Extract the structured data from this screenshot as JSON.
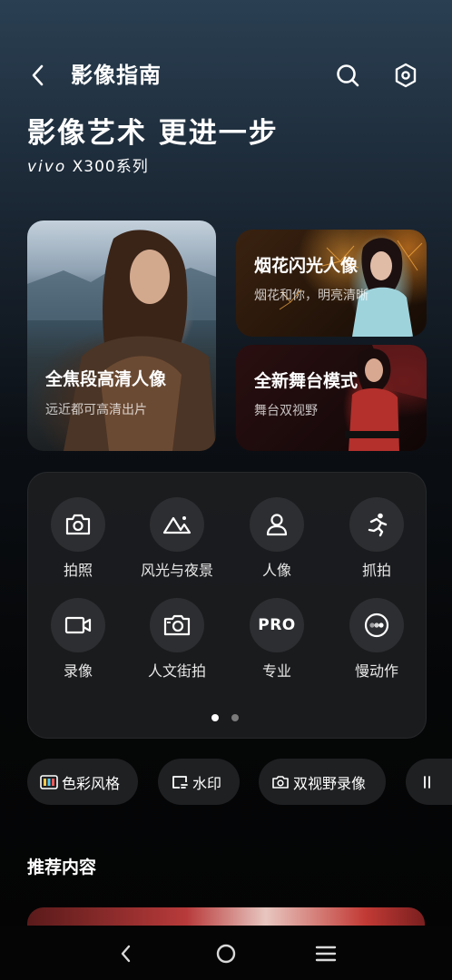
{
  "header": {
    "title": "影像指南"
  },
  "hero": {
    "headline": "影像艺术 更进一步",
    "brand_logo": "vivo",
    "brand_model": "X300系列"
  },
  "cards": [
    {
      "title": "全焦段高清人像",
      "subtitle": "远近都可高清出片"
    },
    {
      "title": "烟花闪光人像",
      "subtitle": "烟花和你，明亮清晰"
    },
    {
      "title": "全新舞台模式",
      "subtitle": "舞台双视野"
    }
  ],
  "modes": [
    {
      "label": "拍照",
      "icon": "camera-icon"
    },
    {
      "label": "风光与夜景",
      "icon": "landscape-icon"
    },
    {
      "label": "人像",
      "icon": "person-icon"
    },
    {
      "label": "抓拍",
      "icon": "running-icon"
    },
    {
      "label": "录像",
      "icon": "video-icon"
    },
    {
      "label": "人文街拍",
      "icon": "street-camera-icon"
    },
    {
      "label": "专业",
      "icon": "pro-icon",
      "icon_text": "PRO"
    },
    {
      "label": "慢动作",
      "icon": "slow-motion-icon"
    }
  ],
  "pager": {
    "active": 0,
    "count": 2
  },
  "chips": [
    {
      "label": "色彩风格",
      "icon": "color-style-icon"
    },
    {
      "label": "水印",
      "icon": "watermark-icon"
    },
    {
      "label": "双视野录像",
      "icon": "dual-view-icon"
    }
  ],
  "recommend": {
    "title": "推荐内容"
  },
  "colors": {
    "accent_dot": "#ffffff",
    "inactive_dot": "#7a7a7a",
    "panel": "#1c1d1f"
  }
}
